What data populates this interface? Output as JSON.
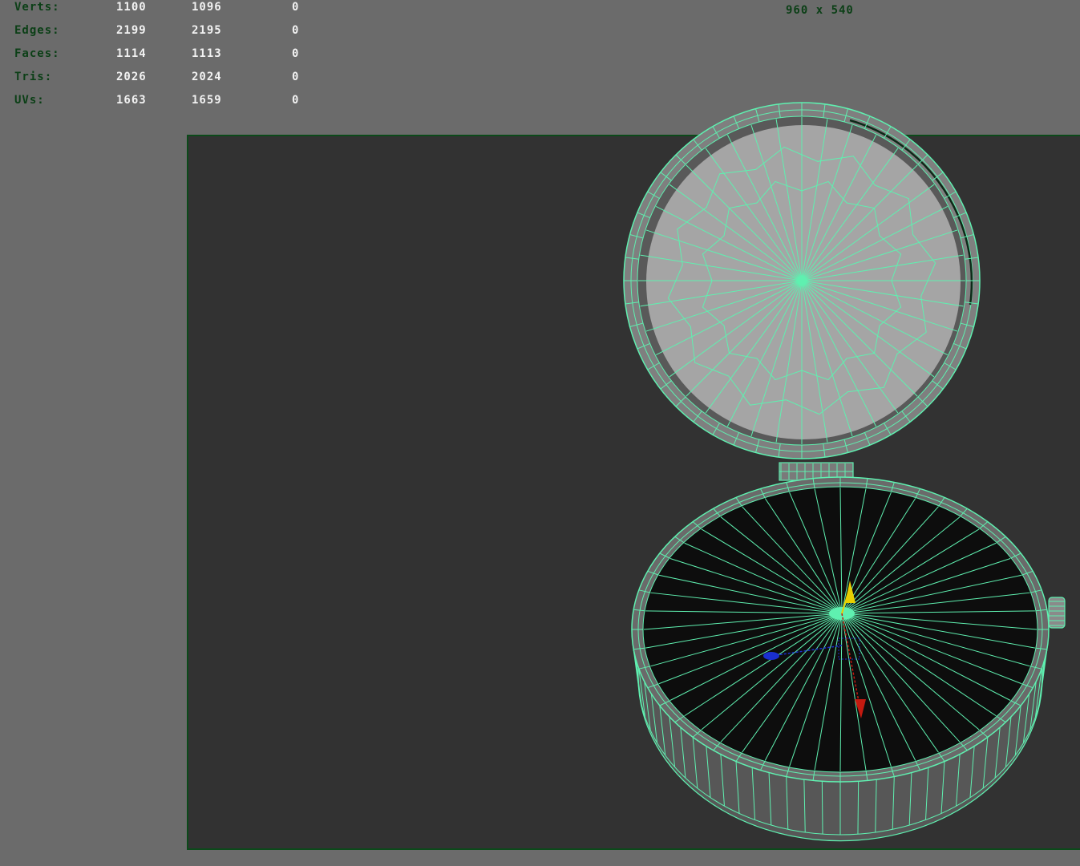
{
  "viewport": {
    "background": "#6b6b6b",
    "gate_fill": "#323232",
    "gate_border": "#0c4a1a",
    "hud_label_color": "#0b3f16",
    "hud_value_color": "#f2f2f2",
    "wire_color": "#5ff0b0"
  },
  "heads_up_display": {
    "rows": [
      {
        "label": "Verts:",
        "values": [
          "1100",
          "1096",
          "0"
        ]
      },
      {
        "label": "Edges:",
        "values": [
          "2199",
          "2195",
          "0"
        ]
      },
      {
        "label": "Faces:",
        "values": [
          "1114",
          "1113",
          "0"
        ]
      },
      {
        "label": "Tris:",
        "values": [
          "2026",
          "2024",
          "0"
        ]
      },
      {
        "label": "UVs:",
        "values": [
          "1663",
          "1659",
          "0"
        ]
      }
    ]
  },
  "resolution_gate": {
    "text": "960 x 540"
  },
  "scene": {
    "object": "pocket-watch-mesh",
    "display_mode": "wireframe-on-shaded",
    "lid_color": "#a5a5a5",
    "case_interior_color": "#0d0d0d",
    "manipulator": {
      "y_axis_color": "#e8d000",
      "x_axis_color": "#c41a10",
      "z_axis_color": "#1a2fd0"
    }
  }
}
